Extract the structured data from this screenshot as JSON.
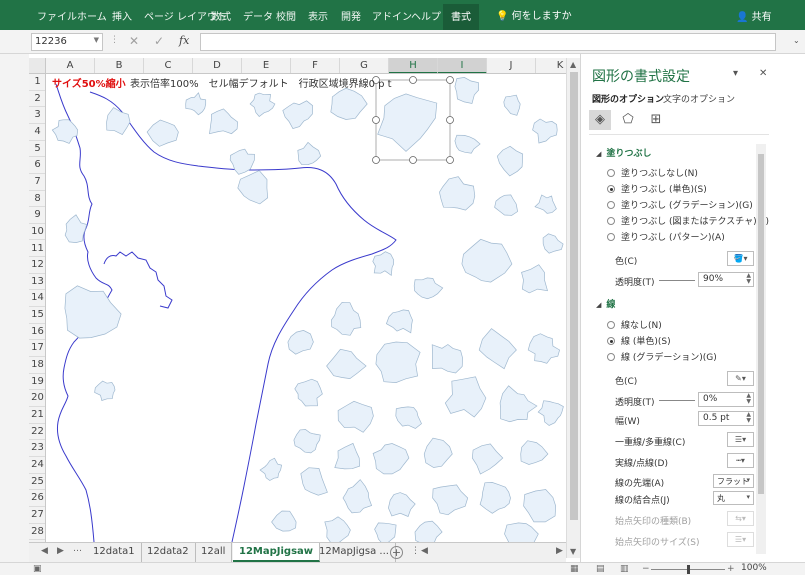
{
  "ribbon": {
    "tabs": [
      "ファイル",
      "ホーム",
      "挿入",
      "ページ レイアウト",
      "数式",
      "データ",
      "校閲",
      "表示",
      "開発",
      "アドイン",
      "ヘルプ"
    ],
    "active_tab": "書式",
    "tell_me": "何をしますか",
    "share": "共有"
  },
  "formula_bar": {
    "name_box": "12236",
    "fx": "fx",
    "formula": ""
  },
  "sheet": {
    "columns": [
      "A",
      "B",
      "C",
      "D",
      "E",
      "F",
      "G",
      "H",
      "I",
      "J",
      "K"
    ],
    "selected_columns": [
      "H",
      "I"
    ],
    "rows": [
      "1",
      "2",
      "3",
      "4",
      "5",
      "6",
      "7",
      "8",
      "9",
      "10",
      "11",
      "12",
      "13",
      "14",
      "15",
      "16",
      "17",
      "18",
      "19",
      "20",
      "21",
      "22",
      "23",
      "24",
      "25",
      "26",
      "27",
      "28"
    ],
    "cell_a1": "サイズ50%縮小",
    "cell_b1": "表示倍率100%　セル幅デフォルト　行政区域境界線0 p t",
    "accent_color": "#217346",
    "shape_fill": "#e8f1fa",
    "shape_stroke": "#9fb8cf",
    "coast_color": "#3a3acc"
  },
  "sheet_tabs": {
    "tabs": [
      "12data1",
      "12data2",
      "12all",
      "12MapJigsaw",
      "12MapJigsa ..."
    ],
    "active": "12MapJigsaw"
  },
  "status": {
    "zoom": "100%"
  },
  "pane": {
    "title": "図形の書式設定",
    "tab_shape": "図形のオプション",
    "tab_text": "文字のオプション",
    "fill_section": "塗りつぶし",
    "fill_options": [
      {
        "label": "塗りつぶしなし(N)",
        "selected": false
      },
      {
        "label": "塗りつぶし (単色)(S)",
        "selected": true
      },
      {
        "label": "塗りつぶし (グラデーション)(G)",
        "selected": false
      },
      {
        "label": "塗りつぶし (図またはテクスチャ)(P)",
        "selected": false
      },
      {
        "label": "塗りつぶし (パターン)(A)",
        "selected": false
      }
    ],
    "fill_color_label": "色(C)",
    "fill_transparency_label": "透明度(T)",
    "fill_transparency_value": "90%",
    "line_section": "線",
    "line_options": [
      {
        "label": "線なし(N)",
        "selected": false
      },
      {
        "label": "線 (単色)(S)",
        "selected": true
      },
      {
        "label": "線 (グラデーション)(G)",
        "selected": false
      }
    ],
    "line_color_label": "色(C)",
    "line_transparency_label": "透明度(T)",
    "line_transparency_value": "0%",
    "width_label": "幅(W)",
    "width_value": "0.5 pt",
    "compound_label": "一重線/多重線(C)",
    "dash_label": "実線/点線(D)",
    "cap_label": "線の先端(A)",
    "cap_value": "フラット",
    "join_label": "線の結合点(J)",
    "join_value": "丸",
    "arrow_start_type_label": "始点矢印の種類(B)",
    "arrow_start_size_label": "始点矢印のサイズ(S)"
  }
}
